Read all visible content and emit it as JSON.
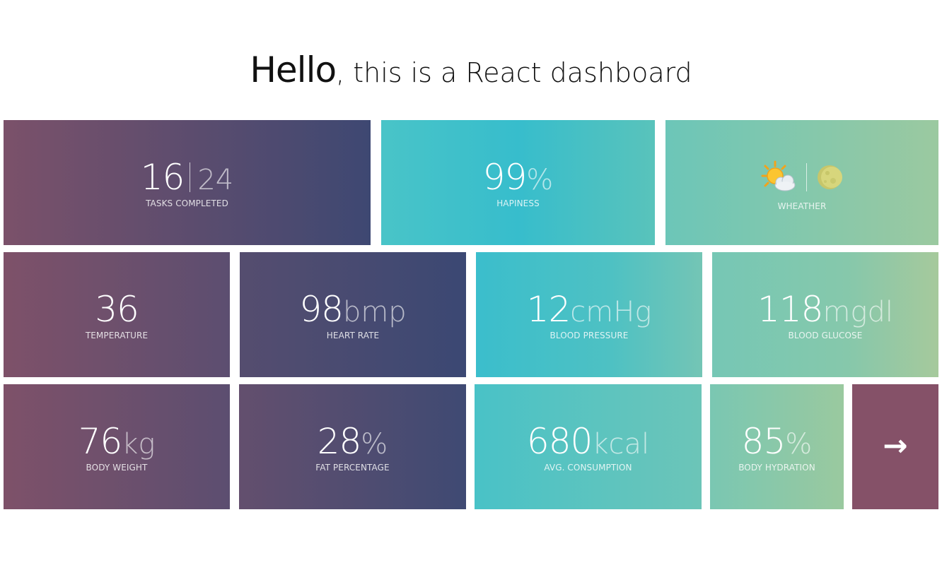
{
  "header": {
    "hello": "Hello",
    "rest": ", this is a React dashboard"
  },
  "tiles": {
    "tasks": {
      "completed": "16",
      "total": "24",
      "caption": "TASKS COMPLETED"
    },
    "happiness": {
      "value": "99",
      "unit": "%",
      "caption": "HAPINESS"
    },
    "weather": {
      "day_icon": "sun-behind-cloud-icon",
      "night_icon": "moon-icon",
      "caption": "WHEATHER"
    },
    "temperature": {
      "value": "36",
      "caption": "TEMPERATURE"
    },
    "heart_rate": {
      "value": "98",
      "unit": "bmp",
      "caption": "HEART RATE"
    },
    "blood_pressure": {
      "value": "12",
      "unit": "cmHg",
      "caption": "BLOOD PRESSURE"
    },
    "blood_glucose": {
      "value": "118",
      "unit": "mgdl",
      "caption": "BLOOD GLUCOSE"
    },
    "body_weight": {
      "value": "76",
      "unit": "kg",
      "caption": "BODY WEIGHT"
    },
    "fat_percentage": {
      "value": "28",
      "unit": "%",
      "caption": "FAT PERCENTAGE"
    },
    "consumption": {
      "value": "680",
      "unit": "kcal",
      "caption": "AVG. CONSUMPTION"
    },
    "hydration": {
      "value": "85",
      "unit": "%",
      "caption": "BODY HYDRATION"
    },
    "next": {
      "icon": "arrow-right-icon",
      "glyph": "→"
    }
  }
}
